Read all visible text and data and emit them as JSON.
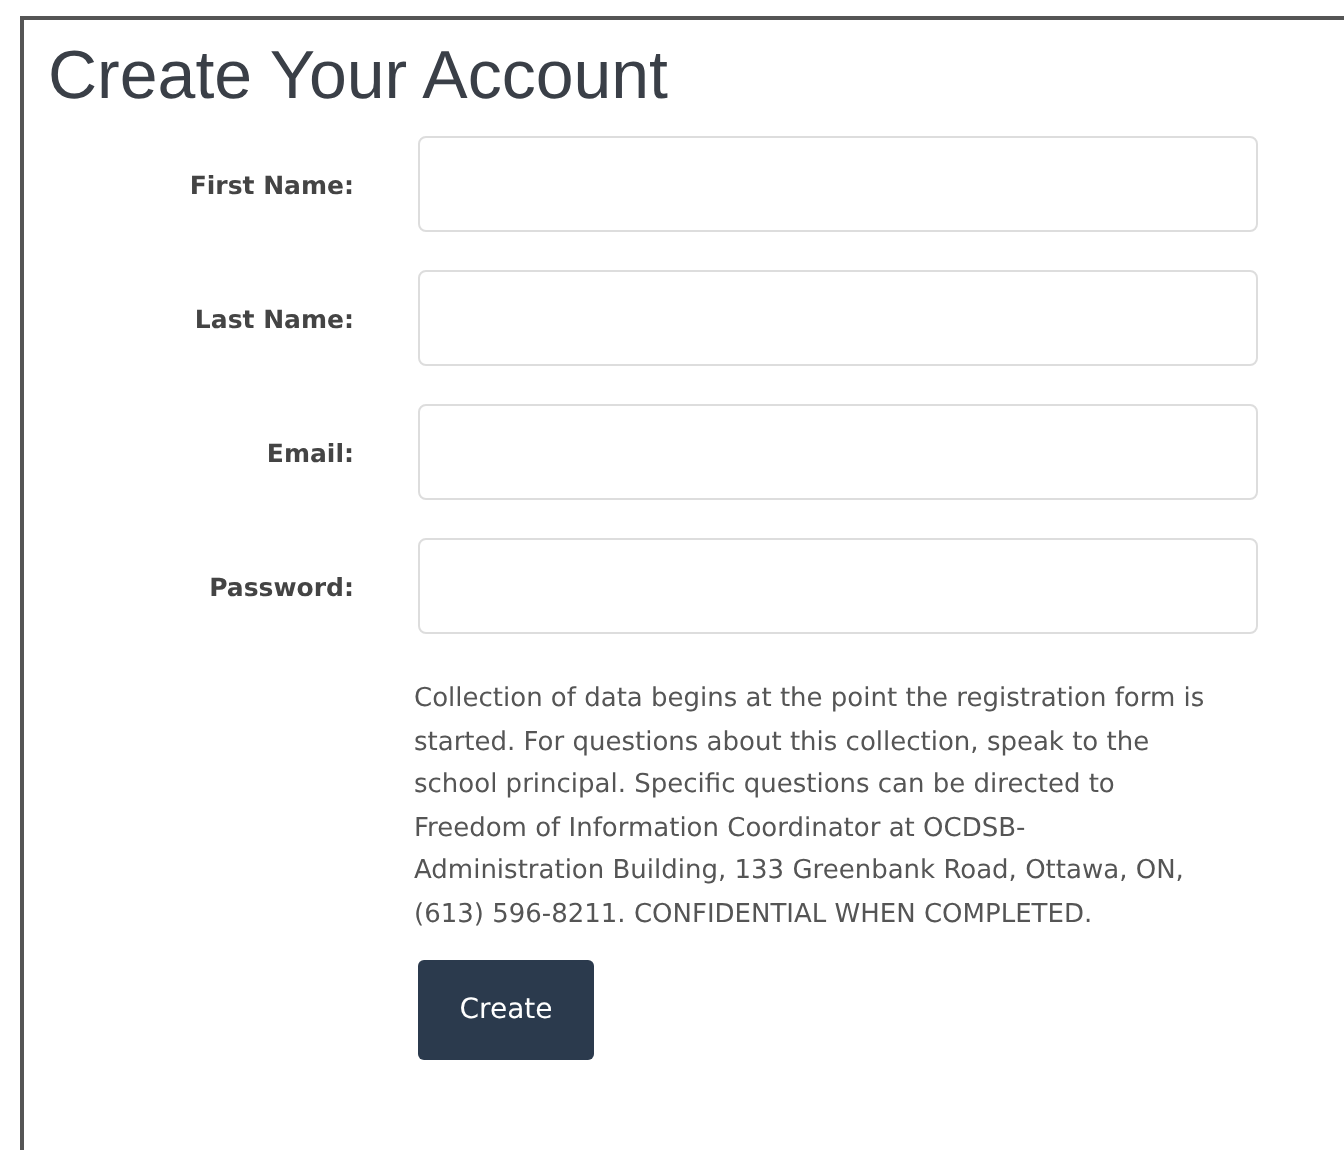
{
  "title": "Create Your Account",
  "fields": [
    {
      "label": "First Name:"
    },
    {
      "label": "Last Name:"
    },
    {
      "label": "Email:"
    },
    {
      "label": "Password:"
    }
  ],
  "notice": "Collection of data begins at the point the registration form is started. For questions about this collection, speak to the school principal. Specific questions can be directed to Freedom of Information Coordinator at OCDSB-Administration Building, 133 Greenbank Road, Ottawa, ON, (613) 596-8211. CONFIDENTIAL WHEN COMPLETED.",
  "button": "Create"
}
